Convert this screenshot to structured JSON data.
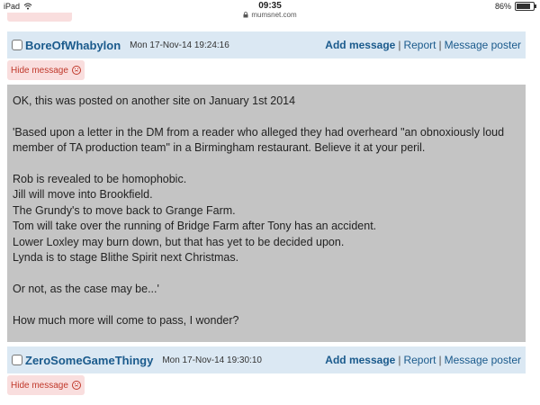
{
  "status_bar": {
    "device": "iPad",
    "time": "09:35",
    "url": "mumsnet.com",
    "battery": "86%",
    "battery_level": 0.86
  },
  "posts": [
    {
      "username": "BoreOfWhabylon",
      "timestamp": "Mon 17-Nov-14 19:24:16",
      "actions": {
        "add": "Add message",
        "report": "Report",
        "message": "Message poster"
      },
      "hide_label": "Hide message",
      "body": [
        "OK, this was posted on another site on January 1st 2014",
        "",
        "'Based upon a letter in the DM from a reader who alleged they had overheard \"an obnoxiously loud member of TA production team\" in a Birmingham restaurant. Believe it at your peril.",
        "",
        "Rob is revealed to be homophobic.",
        "Jill will move into Brookfield.",
        "The Grundy's to move back to Grange Farm.",
        "Tom will take over the running of Bridge Farm after Tony has an accident.",
        "Lower Loxley may burn down, but that has yet to be decided upon.",
        "Lynda is to stage Blithe Spirit next Christmas.",
        "",
        "Or not, as the case may be...'",
        "",
        "How much more will come to pass, I wonder?"
      ]
    },
    {
      "username": "ZeroSomeGameThingy",
      "timestamp": "Mon 17-Nov-14 19:30:10",
      "actions": {
        "add": "Add message",
        "report": "Report",
        "message": "Message poster"
      },
      "hide_label": "Hide message"
    }
  ],
  "colors": {
    "header_bg": "#dbe8f3",
    "link": "#1a5a8c",
    "hide_bg": "#f9dede",
    "hide_text": "#c0392b",
    "message_bg": "#c4c4c4"
  }
}
